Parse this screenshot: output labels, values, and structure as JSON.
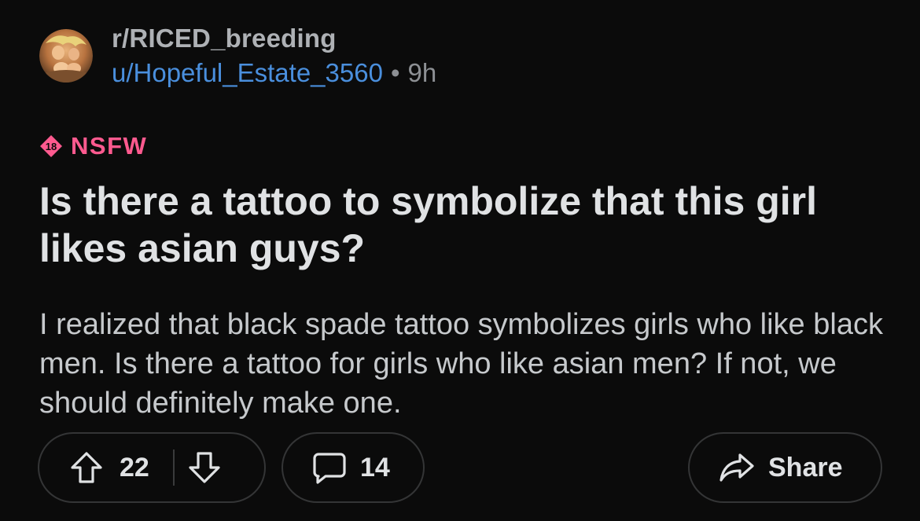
{
  "post": {
    "subreddit": "r/RICED_breeding",
    "author": "u/Hopeful_Estate_3560",
    "separator": "•",
    "age": "9h",
    "nsfw_badge_number": "18",
    "nsfw_label": "NSFW",
    "title": "Is there a tattoo to symbolize that this girl likes asian guys?",
    "body": "I realized that black spade tattoo symbolizes girls who like black men. Is there a tattoo for girls who like asian men? If not, we should definitely make one."
  },
  "actions": {
    "upvotes": "22",
    "comments": "14",
    "share_label": "Share"
  },
  "icons": {
    "upvote": "arrow-up-icon",
    "downvote": "arrow-down-icon",
    "comment": "comment-bubble-icon",
    "share": "share-arrow-icon"
  },
  "colors": {
    "background": "#0b0b0b",
    "username": "#4a8fdd",
    "nsfw": "#ff5a8f",
    "pill_border": "#343536"
  }
}
